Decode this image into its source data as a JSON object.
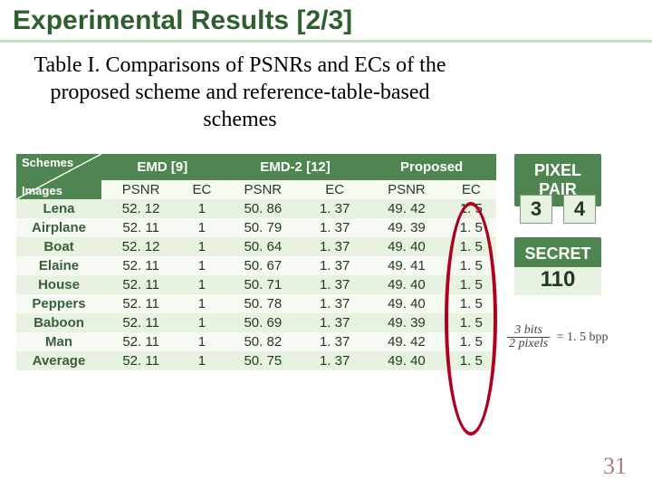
{
  "title": "Experimental Results [2/3]",
  "subtitle": "Table I. Comparisons of PSNRs and ECs of the proposed scheme and reference-table-based schemes",
  "diag": {
    "schemes": "Schemes",
    "images": "Images"
  },
  "methods": [
    "EMD [9]",
    "EMD-2 [12]",
    "Proposed"
  ],
  "subhdr": {
    "psnr": "PSNR",
    "ec": "EC"
  },
  "rows": [
    {
      "name": "Lena",
      "emd_psnr": "52. 12",
      "emd_ec": "1",
      "emd2_psnr": "50. 86",
      "emd2_ec": "1. 37",
      "prop_psnr": "49. 42",
      "prop_ec": "1. 5"
    },
    {
      "name": "Airplane",
      "emd_psnr": "52. 11",
      "emd_ec": "1",
      "emd2_psnr": "50. 79",
      "emd2_ec": "1. 37",
      "prop_psnr": "49. 39",
      "prop_ec": "1. 5"
    },
    {
      "name": "Boat",
      "emd_psnr": "52. 12",
      "emd_ec": "1",
      "emd2_psnr": "50. 64",
      "emd2_ec": "1. 37",
      "prop_psnr": "49. 40",
      "prop_ec": "1. 5"
    },
    {
      "name": "Elaine",
      "emd_psnr": "52. 11",
      "emd_ec": "1",
      "emd2_psnr": "50. 67",
      "emd2_ec": "1. 37",
      "prop_psnr": "49. 41",
      "prop_ec": "1. 5"
    },
    {
      "name": "House",
      "emd_psnr": "52. 11",
      "emd_ec": "1",
      "emd2_psnr": "50. 71",
      "emd2_ec": "1. 37",
      "prop_psnr": "49. 40",
      "prop_ec": "1. 5"
    },
    {
      "name": "Peppers",
      "emd_psnr": "52. 11",
      "emd_ec": "1",
      "emd2_psnr": "50. 78",
      "emd2_ec": "1. 37",
      "prop_psnr": "49. 40",
      "prop_ec": "1. 5"
    },
    {
      "name": "Baboon",
      "emd_psnr": "52. 11",
      "emd_ec": "1",
      "emd2_psnr": "50. 69",
      "emd2_ec": "1. 37",
      "prop_psnr": "49. 39",
      "prop_ec": "1. 5"
    },
    {
      "name": "Man",
      "emd_psnr": "52. 11",
      "emd_ec": "1",
      "emd2_psnr": "50. 82",
      "emd2_ec": "1. 37",
      "prop_psnr": "49. 42",
      "prop_ec": "1. 5"
    },
    {
      "name": "Average",
      "emd_psnr": "52. 11",
      "emd_ec": "1",
      "emd2_psnr": "50. 75",
      "emd2_ec": "1. 37",
      "prop_psnr": "49. 40",
      "prop_ec": "1. 5"
    }
  ],
  "side": {
    "pixel_pair": "PIXEL PAIR",
    "pair_left": "3",
    "pair_right": "4",
    "secret": "SECRET",
    "secret_val": "110"
  },
  "eqn": {
    "num": "3 bits",
    "den": "2 pixels",
    "rhs": "= 1. 5 bpp"
  },
  "pagenum": "31",
  "chart_data": {
    "type": "table",
    "title": "Table I. Comparisons of PSNRs and ECs of the proposed scheme and reference-table-based schemes",
    "columns": [
      "Image",
      "EMD [9] PSNR",
      "EMD [9] EC",
      "EMD-2 [12] PSNR",
      "EMD-2 [12] EC",
      "Proposed PSNR",
      "Proposed EC"
    ],
    "rows": [
      [
        "Lena",
        52.12,
        1,
        50.86,
        1.37,
        49.42,
        1.5
      ],
      [
        "Airplane",
        52.11,
        1,
        50.79,
        1.37,
        49.39,
        1.5
      ],
      [
        "Boat",
        52.12,
        1,
        50.64,
        1.37,
        49.4,
        1.5
      ],
      [
        "Elaine",
        52.11,
        1,
        50.67,
        1.37,
        49.41,
        1.5
      ],
      [
        "House",
        52.11,
        1,
        50.71,
        1.37,
        49.4,
        1.5
      ],
      [
        "Peppers",
        52.11,
        1,
        50.78,
        1.37,
        49.4,
        1.5
      ],
      [
        "Baboon",
        52.11,
        1,
        50.69,
        1.37,
        49.39,
        1.5
      ],
      [
        "Man",
        52.11,
        1,
        50.82,
        1.37,
        49.42,
        1.5
      ],
      [
        "Average",
        52.11,
        1,
        50.75,
        1.37,
        49.4,
        1.5
      ]
    ]
  }
}
